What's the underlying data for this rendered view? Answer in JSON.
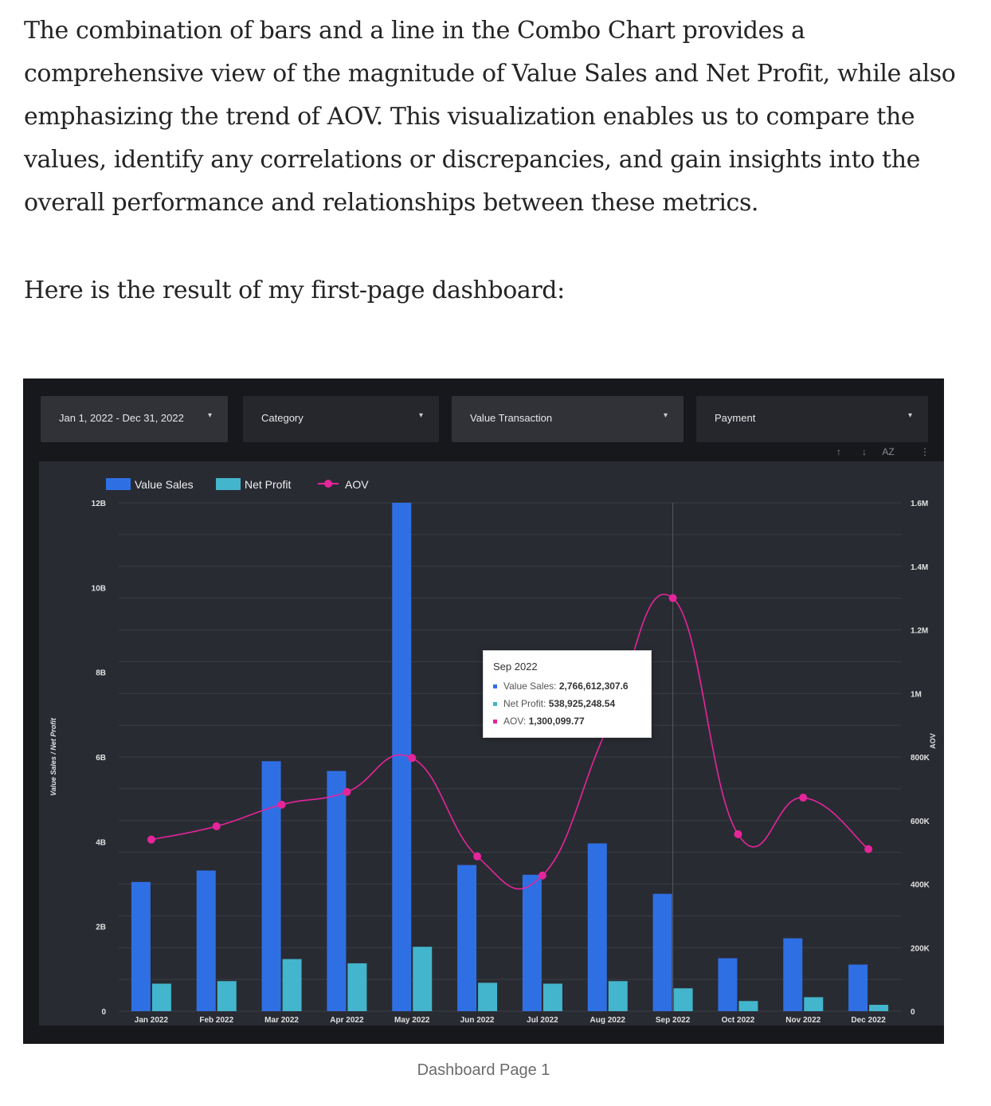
{
  "article": {
    "paragraph_1": "The combination of bars and a line in the Combo Chart provides a comprehensive view of the magnitude of Value Sales and Net Profit, while also emphasizing the trend of AOV. This visualization enables us to compare the values, identify any correlations or discrepancies, and gain insights into the overall performance and relationships between these metrics.",
    "paragraph_2": "Here is the result of my first-page dashboard:",
    "caption": "Dashboard Page 1"
  },
  "filters": [
    {
      "label": "Jan 1, 2022 - Dec 31, 2022",
      "icon": "caret-down-icon"
    },
    {
      "label": "Category",
      "icon": "caret-down-icon"
    },
    {
      "label": "Value Transaction",
      "icon": "caret-down-icon"
    },
    {
      "label": "Payment",
      "icon": "caret-down-icon"
    }
  ],
  "toolbar_icons": [
    "sort-asc-icon",
    "sort-desc-icon",
    "sort-az-icon",
    "more-vert-icon"
  ],
  "tooltip": {
    "title": "Sep 2022",
    "rows": [
      {
        "name": "Value Sales:",
        "value": "2,766,612,307.6",
        "color": "#2f6fe4"
      },
      {
        "name": "Net Profit:",
        "value": "538,925,248.54",
        "color": "#43b5cc"
      },
      {
        "name": "AOV:",
        "value": "1,300,099.77",
        "color": "#e5259a"
      }
    ]
  },
  "chart_data": {
    "type": "combo",
    "categories": [
      "Jan 2022",
      "Feb 2022",
      "Mar 2022",
      "Apr 2022",
      "May 2022",
      "Jun 2022",
      "Jul 2022",
      "Aug 2022",
      "Sep 2022",
      "Oct 2022",
      "Nov 2022",
      "Dec 2022"
    ],
    "series": [
      {
        "name": "Value Sales",
        "kind": "bar",
        "axis": "left",
        "color": "#2f6fe4",
        "values": [
          3050000000.0,
          3320000000.0,
          5900000000.0,
          5670000000.0,
          12000000000.0,
          3450000000.0,
          3220000000.0,
          3960000000.0,
          2770000000.0,
          1250000000.0,
          1720000000.0,
          1100000000.0
        ]
      },
      {
        "name": "Net Profit",
        "kind": "bar",
        "axis": "left",
        "color": "#43b5cc",
        "values": [
          650000000.0,
          710000000.0,
          1230000000.0,
          1130000000.0,
          1520000000.0,
          670000000.0,
          650000000.0,
          710000000.0,
          540000000.0,
          240000000.0,
          330000000.0,
          150000000.0
        ]
      },
      {
        "name": "AOV",
        "kind": "line",
        "axis": "right",
        "color": "#e5259a",
        "values": [
          540000,
          582000,
          650000,
          690000,
          797000,
          487000,
          427000,
          893000,
          1300100,
          557000,
          672000,
          510000
        ]
      }
    ],
    "y_left": {
      "label": "Value Sales / Net Profit",
      "min": 0,
      "max": 12000000000.0,
      "ticks": [
        "0",
        "2B",
        "4B",
        "6B",
        "8B",
        "10B",
        "12B"
      ]
    },
    "y_right": {
      "label": "AOV",
      "min": 0,
      "max": 1600000,
      "ticks": [
        "0",
        "200K",
        "400K",
        "600K",
        "800K",
        "1M",
        "1.2M",
        "1.4M",
        "1.6M"
      ]
    },
    "legend": "top-left",
    "grid": true,
    "highlighted_category": "Sep 2022"
  }
}
